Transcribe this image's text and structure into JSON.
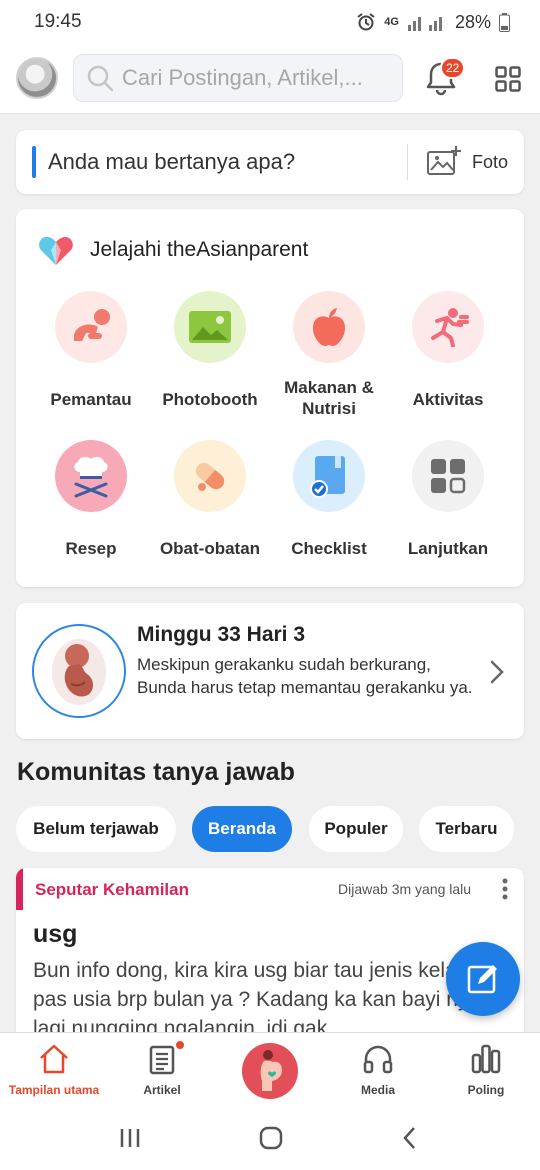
{
  "status": {
    "time": "19:45",
    "network": "4G",
    "battery": "28%"
  },
  "header": {
    "search_placeholder": "Cari Postingan, Artikel,...",
    "notification_count": "22"
  },
  "ask": {
    "prompt": "Anda mau bertanya apa?",
    "photo_label": "Foto"
  },
  "explore": {
    "title": "Jelajahi theAsianparent",
    "items": [
      {
        "label": "Pemantau",
        "icon": "baby-crawl-icon",
        "bg": "#fde8e6"
      },
      {
        "label": "Photobooth",
        "icon": "image-icon",
        "bg": "#e4f3c9"
      },
      {
        "label": "Makanan & Nutrisi",
        "icon": "apple-icon",
        "bg": "#fde6e1"
      },
      {
        "label": "Aktivitas",
        "icon": "running-icon",
        "bg": "#fde9ea"
      },
      {
        "label": "Resep",
        "icon": "chef-hat-icon",
        "bg": "#f7a9b8"
      },
      {
        "label": "Obat-obatan",
        "icon": "pill-icon",
        "bg": "#fdf0d6"
      },
      {
        "label": "Checklist",
        "icon": "checklist-icon",
        "bg": "#dbeefc"
      },
      {
        "label": "Lanjutkan",
        "icon": "more-grid-icon",
        "bg": "#f1f1f1"
      }
    ]
  },
  "pregnancy": {
    "title": "Minggu 33 Hari 3",
    "description": "Meskipun gerakanku sudah berkurang, Bunda harus tetap memantau gerakanku ya."
  },
  "community": {
    "title": "Komunitas tanya jawab",
    "filters": [
      {
        "label": "Belum terjawab",
        "active": false
      },
      {
        "label": "Beranda",
        "active": true
      },
      {
        "label": "Populer",
        "active": false
      },
      {
        "label": "Terbaru",
        "active": false
      }
    ]
  },
  "post": {
    "category": "Seputar Kehamilan",
    "time": "Dijawab 3m yang lalu",
    "title": "usg",
    "body": "Bun info dong, kira kira usg biar tau jenis kelamin pas usia brp bulan ya ? Kadang ka kan bayi nya lagi nungging ngalangin. idi gak"
  },
  "bottom_nav": {
    "items": [
      {
        "label": "Tampilan utama",
        "icon": "home-icon",
        "active": true
      },
      {
        "label": "Artikel",
        "icon": "article-icon",
        "active": false
      },
      {
        "label": "",
        "icon": "pregnancy-icon",
        "active": false
      },
      {
        "label": "Media",
        "icon": "headphones-icon",
        "active": false
      },
      {
        "label": "Poling",
        "icon": "poll-icon",
        "active": false
      }
    ]
  },
  "colors": {
    "accent": "#1f7de6",
    "active_nav": "#e8472b",
    "category": "#d6255a"
  }
}
